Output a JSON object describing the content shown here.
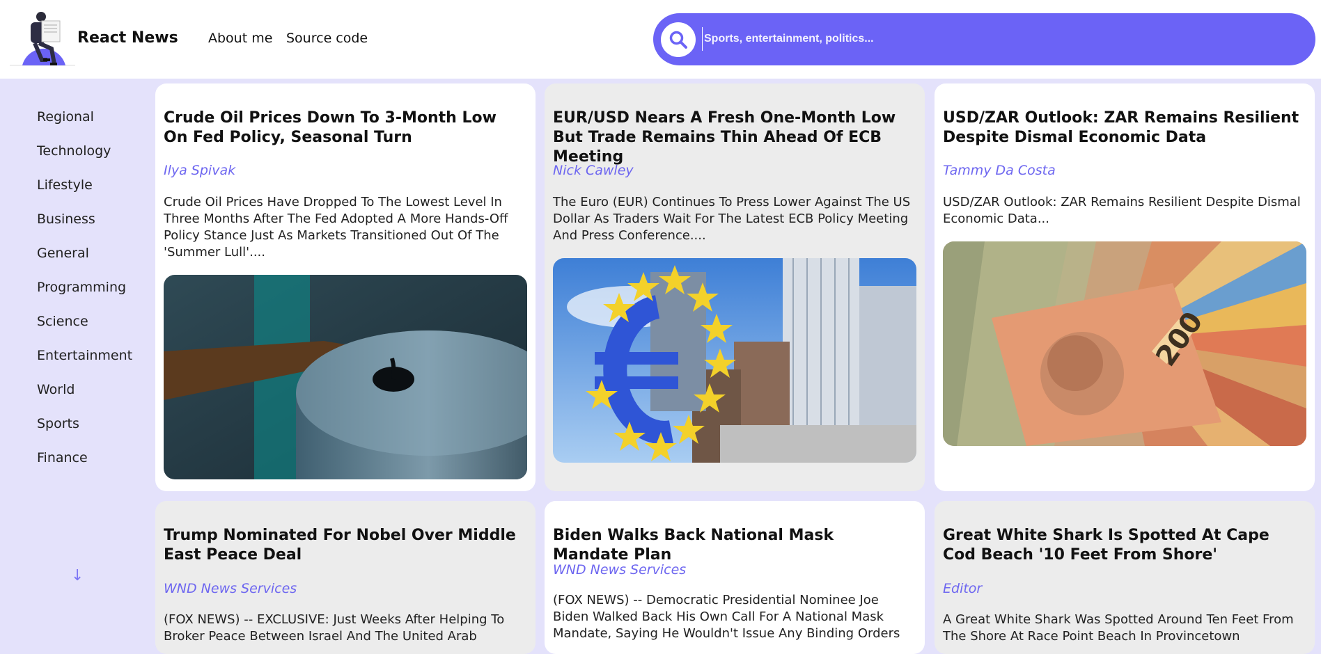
{
  "header": {
    "brand": "React News",
    "nav": [
      "About me",
      "Source code"
    ]
  },
  "search": {
    "placeholder": "Sports, entertainment, politics..."
  },
  "sidebar": {
    "categories": [
      "Regional",
      "Technology",
      "Lifestyle",
      "Business",
      "General",
      "Programming",
      "Science",
      "Entertainment",
      "World",
      "Sports",
      "Finance"
    ],
    "scroll_icon": "arrow-down-icon"
  },
  "articles": [
    {
      "title": "Crude Oil Prices Down To 3-Month Low On Fed Policy, Seasonal Turn",
      "author": "Ilya Spivak",
      "description": "Crude Oil Prices Have Dropped To The Lowest Level In Three Months After The Fed Adopted A More Hands-Off Policy Stance Just As Markets Transitioned Out Of The 'Summer Lull'....",
      "image": "oil-barrel-image"
    },
    {
      "title": "EUR/USD Nears A Fresh One-Month Low But Trade Remains Thin Ahead Of ECB Meeting",
      "author": "Nick Cawley",
      "description": "The Euro (EUR) Continues To Press Lower Against The US Dollar As Traders Wait For The Latest ECB Policy Meeting And Press Conference....",
      "image": "euro-sculpture-image"
    },
    {
      "title": "USD/ZAR Outlook: ZAR Remains Resilient Despite Dismal Economic Data",
      "author": "Tammy Da Costa",
      "description": "USD/ZAR Outlook: ZAR Remains Resilient Despite Dismal Economic Data...",
      "image": "rand-banknotes-image"
    },
    {
      "title": "Trump Nominated For Nobel Over Middle East Peace Deal",
      "author": "WND News Services",
      "description": "(FOX NEWS) -- EXCLUSIVE: Just Weeks After Helping To Broker Peace Between Israel And The United Arab"
    },
    {
      "title": "Biden Walks Back National Mask Mandate Plan",
      "author": "WND News Services",
      "description": "(FOX NEWS) -- Democratic Presidential Nominee Joe Biden Walked Back His Own Call For A National Mask Mandate, Saying He Wouldn't Issue Any Binding Orders"
    },
    {
      "title": "Great White Shark Is Spotted At Cape Cod Beach '10 Feet From Shore'",
      "author": "Editor",
      "description": "A Great White Shark Was Spotted Around Ten Feet From The Shore At Race Point Beach In Provincetown"
    }
  ],
  "colors": {
    "accent": "#6b63f6",
    "page_background": "#e4e2fb",
    "author_text": "#6d66f0"
  }
}
